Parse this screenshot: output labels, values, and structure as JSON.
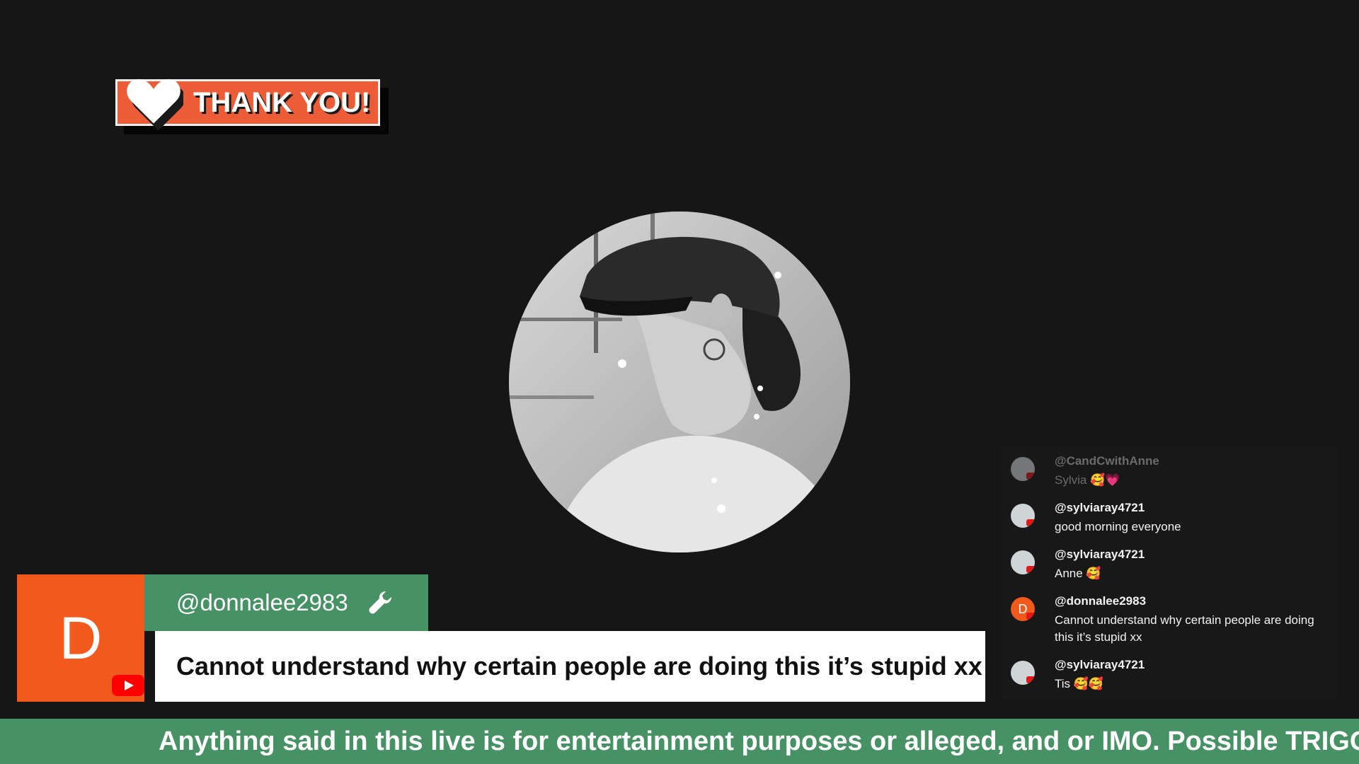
{
  "badge": {
    "label": "THANK YOU!",
    "icon": "heart-icon"
  },
  "colors": {
    "background": "#161616",
    "badge_orange": "#ec5c36",
    "lower_third_green": "#479264",
    "avatar_orange": "#f25a1d",
    "youtube_red": "#ff0000"
  },
  "chat": {
    "messages": [
      {
        "user": "@CandCwithAnne",
        "text": "Sylvia 🥰💗",
        "faded": true
      },
      {
        "user": "@sylviaray4721",
        "text": "good morning everyone"
      },
      {
        "user": "@sylviaray4721",
        "text": "Anne 🥰"
      },
      {
        "user": "@donnalee2983",
        "text": "Cannot understand why certain people are doing this it’s stupid xx",
        "avatar_letter": "D"
      },
      {
        "user": "@sylviaray4721",
        "text": "Tis 🥰🥰"
      }
    ]
  },
  "lower_third": {
    "avatar_letter": "D",
    "username": "@donnalee2983",
    "message": "Cannot understand why certain people are doing this it’s stupid xx",
    "icons": [
      "youtube-icon",
      "wrench-icon"
    ]
  },
  "ticker": {
    "text": "Anything said in this live is for entertainment purposes or alleged, and or IMO. Possible TRIGGE"
  }
}
